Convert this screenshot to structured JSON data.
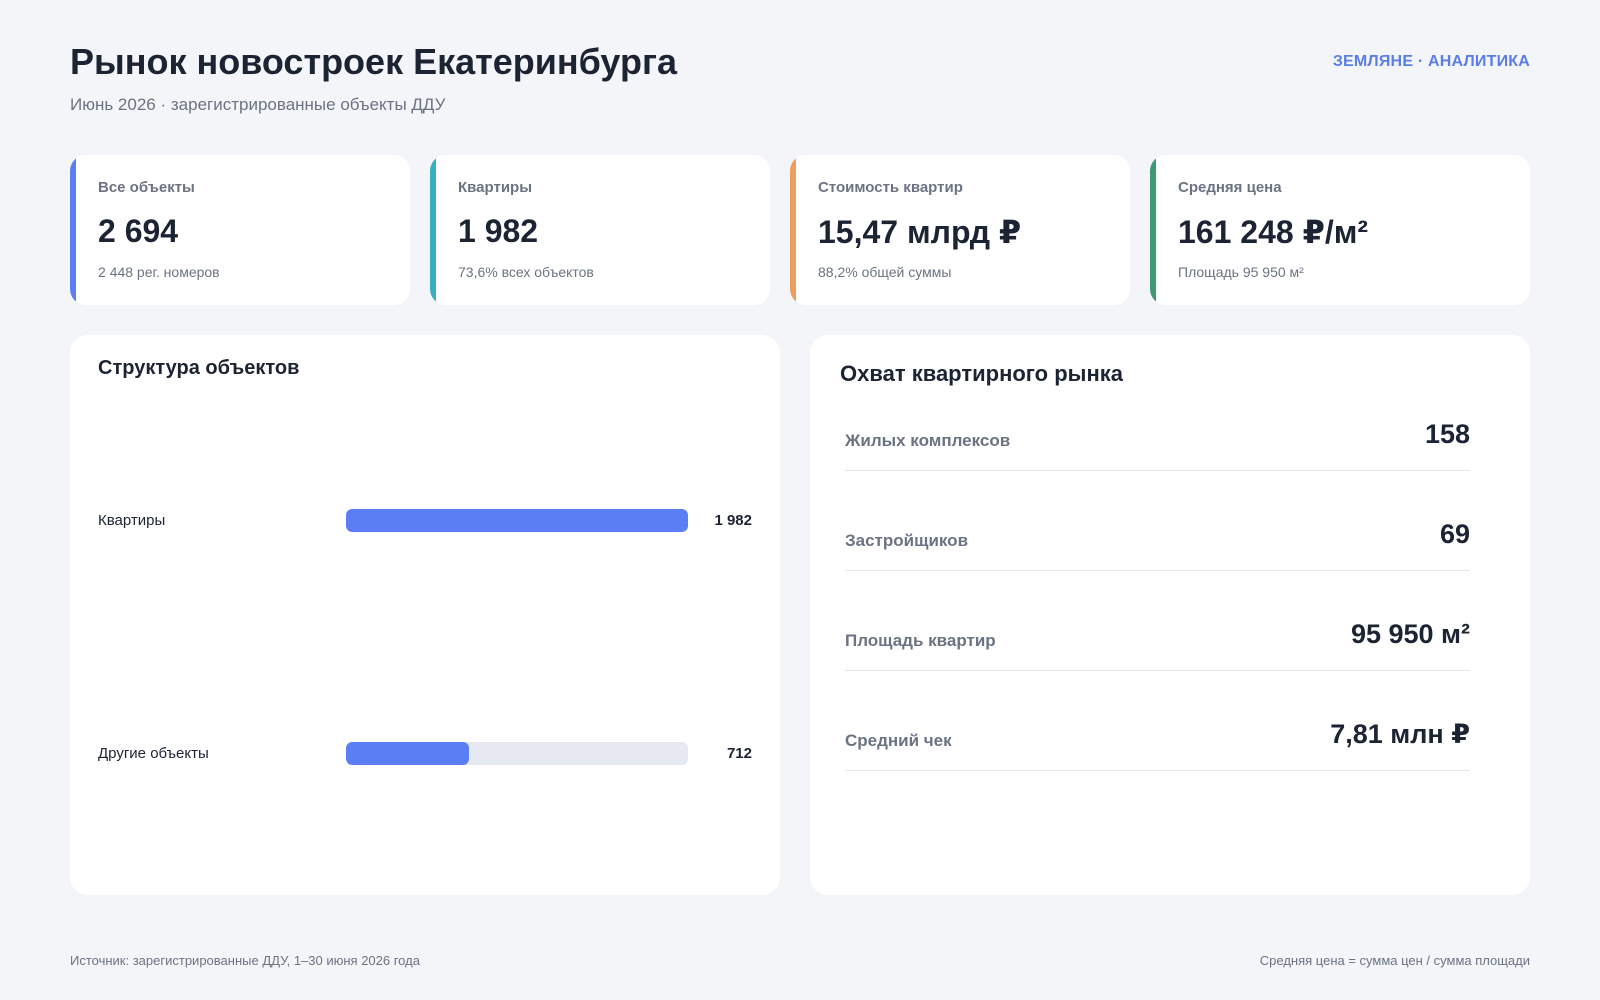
{
  "header": {
    "title": "Рынок новостроек Екатеринбурга",
    "subtitle": "Июнь 2026 · зарегистрированные объекты ДДУ",
    "brand": "ЗЕМЛЯНЕ · АНАЛИТИКА"
  },
  "kpis": [
    {
      "label": "Все объекты",
      "value": "2 694",
      "note": "2 448 рег. номеров",
      "accent_color": "#5b7ef5"
    },
    {
      "label": "Квартиры",
      "value": "1 982",
      "note": "73,6% всех объектов",
      "accent_color": "#36b0c0"
    },
    {
      "label": "Стоимость квартир",
      "value": "15,47 млрд ₽",
      "note": "88,2% общей суммы",
      "accent_color": "#ef9d5a"
    },
    {
      "label": "Средняя цена",
      "value": "161 248 ₽/м²",
      "note": "Площадь 95 950 м²",
      "accent_color": "#3f9a76"
    }
  ],
  "structure": {
    "title": "Структура объектов",
    "bar_color": "#5b7ef5",
    "track_color": "#e6e9f0"
  },
  "chart_data": {
    "type": "bar",
    "orientation": "horizontal",
    "categories": [
      "Квартиры",
      "Другие объекты"
    ],
    "values": [
      1982,
      712
    ],
    "value_labels": [
      "1 982",
      "712"
    ],
    "xlim": [
      0,
      1982
    ]
  },
  "coverage": {
    "title": "Охват квартирного рынка",
    "rows": [
      {
        "label": "Жилых комплексов",
        "value": "158"
      },
      {
        "label": "Застройщиков",
        "value": "69"
      },
      {
        "label": "Площадь квартир",
        "value": "95 950 м²"
      },
      {
        "label": "Средний чек",
        "value": "7,81 млн ₽"
      }
    ]
  },
  "footer": {
    "source": "Источник: зарегистрированные ДДУ, 1–30 июня 2026 года",
    "formula": "Средняя цена = сумма цен / сумма площади"
  }
}
